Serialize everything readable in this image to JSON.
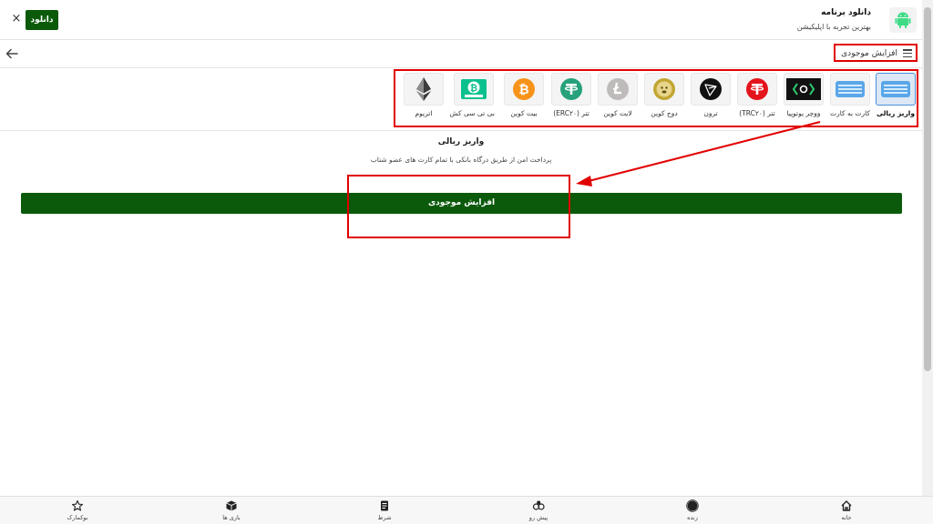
{
  "banner": {
    "close_icon": "×",
    "download_button": "دانلود",
    "app_title": "دانلود برنامه",
    "app_subtitle": "بهترین تجربه با اپلیکیشن"
  },
  "header": {
    "title": "افزایش موجودی"
  },
  "methods": [
    {
      "label": "واریز ریالی",
      "icon": "bank-card-icon",
      "active": true
    },
    {
      "label": "کارت به کارت",
      "icon": "card-icon",
      "active": false
    },
    {
      "label": "ووچر یوتوپیا",
      "icon": "utopia-icon",
      "active": false
    },
    {
      "label": "تتر (TRC۲۰)",
      "icon": "tether-icon",
      "active": false
    },
    {
      "label": "ترون",
      "icon": "tron-icon",
      "active": false
    },
    {
      "label": "دوج کوین",
      "icon": "dogecoin-icon",
      "active": false
    },
    {
      "label": "لایت کوین",
      "icon": "litecoin-icon",
      "active": false
    },
    {
      "label": "تتر (ERC۲۰)",
      "icon": "tether-icon",
      "active": false
    },
    {
      "label": "بیت کوین",
      "icon": "bitcoin-icon",
      "active": false
    },
    {
      "label": "بی تی سی کش",
      "icon": "bitcoin-cash-icon",
      "active": false
    },
    {
      "label": "اتریوم",
      "icon": "ethereum-icon",
      "active": false
    }
  ],
  "content": {
    "section_title": "واریز ریالی",
    "section_desc": "پرداخت امن از طریق درگاه بانکی با تمام کارت های عضو شتاب",
    "submit_button": "افزایش موجودی"
  },
  "bottom_nav": [
    {
      "label": "خانه",
      "icon": "home-icon"
    },
    {
      "label": "زنده",
      "icon": "live-icon"
    },
    {
      "label": "پیش رو",
      "icon": "upcoming-icon"
    },
    {
      "label": "شرط",
      "icon": "bet-slip-icon"
    },
    {
      "label": "بازی ها",
      "icon": "games-icon"
    },
    {
      "label": "بوکمارک",
      "icon": "bookmark-star-icon"
    }
  ],
  "colors": {
    "primary_green": "#0b5a0b",
    "highlight_red": "#e10000",
    "active_blue": "#4a90d9"
  }
}
